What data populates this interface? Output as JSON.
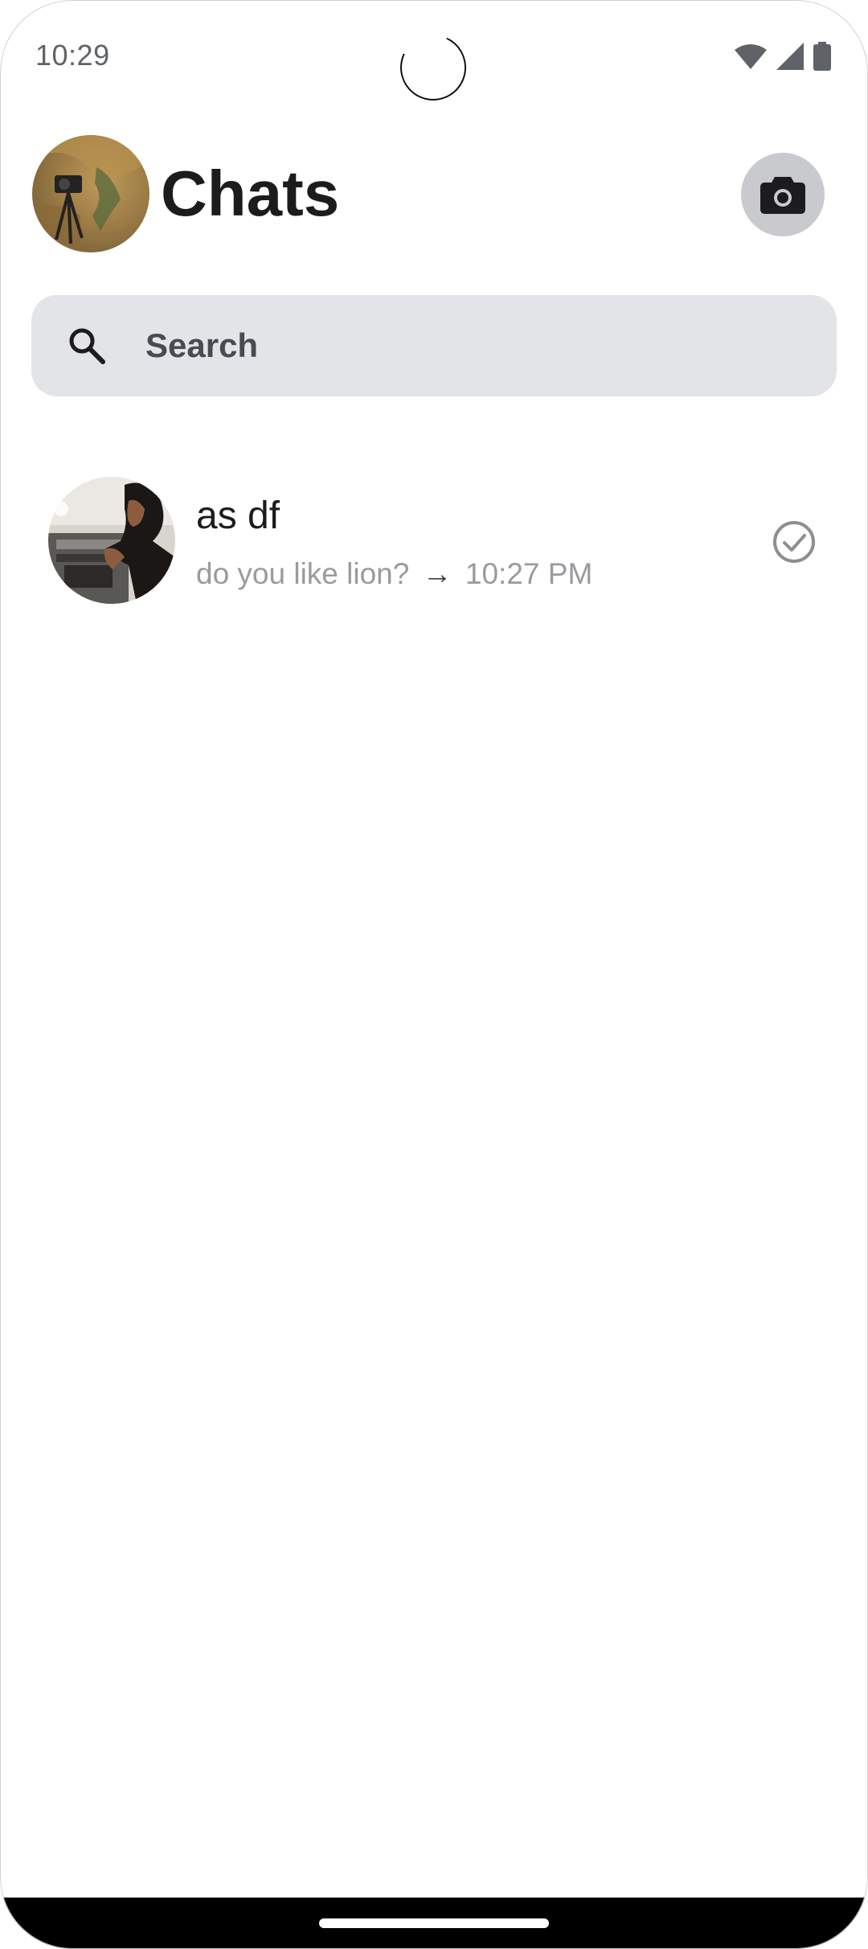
{
  "status_bar": {
    "time": "10:29",
    "icons": [
      "wifi-icon",
      "cellular-signal-icon",
      "battery-icon"
    ]
  },
  "header": {
    "title": "Chats",
    "profile_avatar": "profile-photo",
    "camera_button_icon": "camera-icon"
  },
  "search": {
    "placeholder": "Search",
    "value": "",
    "icon": "search-icon"
  },
  "chats": [
    {
      "name": "as df",
      "last_message": "do you like lion?",
      "separator": "→",
      "timestamp": "10:27 PM",
      "status_icon": "read-check-icon"
    }
  ],
  "colors": {
    "background": "#ffffff",
    "search_background": "#e3e4e8",
    "camera_button_background": "#c9cace",
    "title_text": "#1c1c1e",
    "secondary_text": "#9a9a9f",
    "nav_bar": "#000000"
  }
}
